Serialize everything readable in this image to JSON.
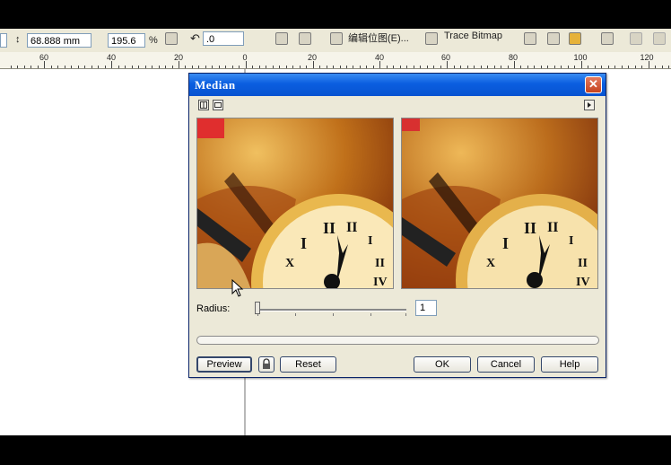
{
  "toolbar": {
    "height_value": "68.888 mm",
    "scale_value": "195.6",
    "scale_unit": "%",
    "rotation_value": ".0",
    "edit_bitmap_label": "编辑位图(E)...",
    "trace_bitmap_label": "Trace Bitmap"
  },
  "ruler": {
    "labels": [
      "60",
      "40",
      "20",
      "0",
      "20",
      "40",
      "60",
      "80",
      "100",
      "120"
    ]
  },
  "dialog": {
    "title": "Median",
    "radius_label": "Radius:",
    "radius_value": "1",
    "radius_max": 10,
    "buttons": {
      "preview": "Preview",
      "reset": "Reset",
      "ok": "OK",
      "cancel": "Cancel",
      "help": "Help"
    },
    "icons": {
      "close": "close-icon",
      "preview_toggle_1": "split-preview-icon",
      "preview_toggle_2": "single-preview-icon",
      "menu": "menu-arrow-icon",
      "lock": "lock-icon"
    }
  }
}
